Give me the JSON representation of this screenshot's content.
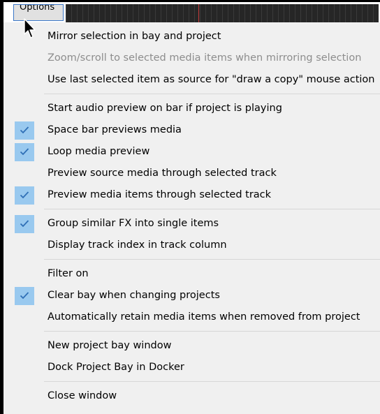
{
  "toolbar": {
    "options_label": "Options"
  },
  "menu": {
    "groups": [
      {
        "items": [
          {
            "label": "Mirror selection in bay and project",
            "checked": false,
            "enabled": true
          },
          {
            "label": "Zoom/scroll to selected media items when mirroring selection",
            "checked": false,
            "enabled": false
          },
          {
            "label": "Use last selected item as source for \"draw a copy\" mouse action",
            "checked": false,
            "enabled": true
          }
        ]
      },
      {
        "items": [
          {
            "label": "Start audio preview on bar if project is playing",
            "checked": false,
            "enabled": true
          },
          {
            "label": "Space bar previews media",
            "checked": true,
            "enabled": true
          },
          {
            "label": "Loop media preview",
            "checked": true,
            "enabled": true
          },
          {
            "label": "Preview source media through selected track",
            "checked": false,
            "enabled": true
          },
          {
            "label": "Preview media items through selected track",
            "checked": true,
            "enabled": true
          }
        ]
      },
      {
        "items": [
          {
            "label": "Group similar FX into single items",
            "checked": true,
            "enabled": true
          },
          {
            "label": "Display track index in track column",
            "checked": false,
            "enabled": true
          }
        ]
      },
      {
        "items": [
          {
            "label": "Filter on",
            "checked": false,
            "enabled": true
          },
          {
            "label": "Clear bay when changing projects",
            "checked": true,
            "enabled": true
          },
          {
            "label": "Automatically retain media items when removed from project",
            "checked": false,
            "enabled": true
          }
        ]
      },
      {
        "items": [
          {
            "label": "New project bay window",
            "checked": false,
            "enabled": true
          },
          {
            "label": "Dock Project Bay in Docker",
            "checked": false,
            "enabled": true
          }
        ]
      },
      {
        "items": [
          {
            "label": "Close window",
            "checked": false,
            "enabled": true
          }
        ]
      }
    ]
  },
  "colors": {
    "menu_bg": "#f0f0f0",
    "check_bg": "#99c9ef",
    "check_mark": "#2f6fb6",
    "disabled_text": "#8d8d8d",
    "separator": "#d7d7d7"
  }
}
